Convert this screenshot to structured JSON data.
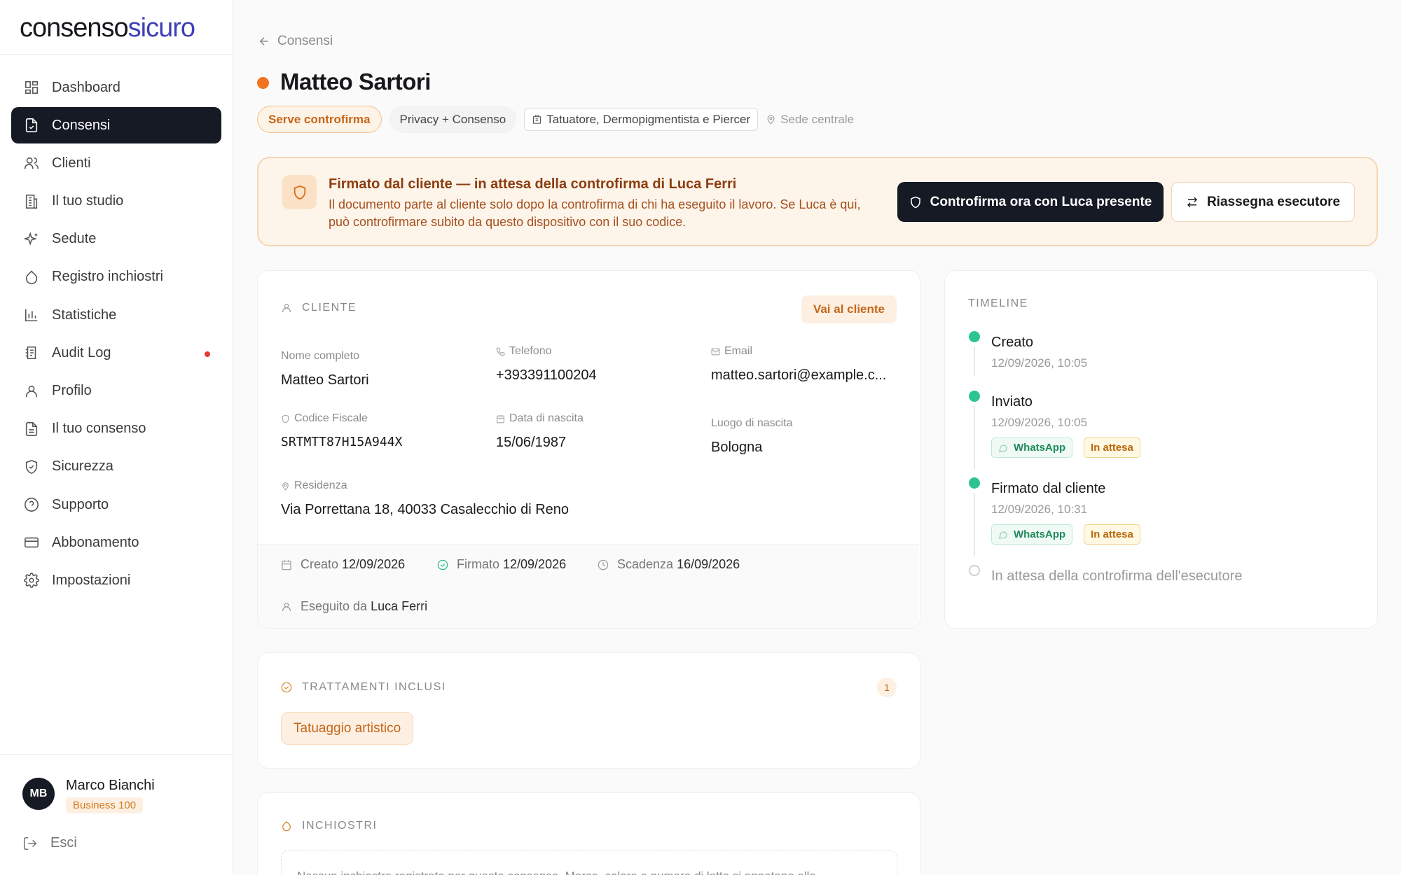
{
  "app": {
    "logo_part1": "consenso",
    "logo_part2": "sicuro",
    "brand_color": "#3f3fb8"
  },
  "sidebar": {
    "items": [
      {
        "label": "Dashboard",
        "icon": "dashboard-icon"
      },
      {
        "label": "Consensi",
        "icon": "document-icon",
        "active": true
      },
      {
        "label": "Clienti",
        "icon": "users-icon"
      },
      {
        "label": "Il tuo studio",
        "icon": "building-icon"
      },
      {
        "label": "Sedute",
        "icon": "sparkles-icon"
      },
      {
        "label": "Registro inchiostri",
        "icon": "droplet-icon"
      },
      {
        "label": "Statistiche",
        "icon": "bar-chart-icon"
      },
      {
        "label": "Audit Log",
        "icon": "audit-icon",
        "notification": true
      },
      {
        "label": "Profilo",
        "icon": "user-icon"
      },
      {
        "label": "Il tuo consenso",
        "icon": "file-icon"
      },
      {
        "label": "Sicurezza",
        "icon": "shield-check-icon"
      },
      {
        "label": "Supporto",
        "icon": "help-circle-icon"
      },
      {
        "label": "Abbonamento",
        "icon": "credit-card-icon"
      },
      {
        "label": "Impostazioni",
        "icon": "gear-icon"
      }
    ],
    "user": {
      "initials": "MB",
      "name": "Marco Bianchi",
      "plan": "Business 100"
    },
    "logout_label": "Esci"
  },
  "header": {
    "back_label": "Consensi",
    "title": "Matteo Sartori",
    "status_color": "#f0741f",
    "chips": {
      "status": "Serve controfirma",
      "type": "Privacy + Consenso",
      "category": "Tatuatore, Dermopigmentista e Piercer",
      "location": "Sede centrale"
    }
  },
  "banner": {
    "title": "Firmato dal cliente — in attesa della controfirma di Luca Ferri",
    "text": "Il documento parte al cliente solo dopo la controfirma di chi ha eseguito il lavoro. Se Luca è qui, può controfirmare subito da questo dispositivo con il suo codice.",
    "primary_button": "Controfirma ora con Luca presente",
    "secondary_button": "Riassegna esecutore"
  },
  "client": {
    "section_label": "CLIENTE",
    "go_button": "Vai al cliente",
    "fields": {
      "full_name_label": "Nome completo",
      "full_name": "Matteo Sartori",
      "phone_label": "Telefono",
      "phone": "+393391100204",
      "email_label": "Email",
      "email": "matteo.sartori@example.c...",
      "tax_code_label": "Codice Fiscale",
      "tax_code": "SRTMTT87H15A944X",
      "birth_date_label": "Data di nascita",
      "birth_date": "15/06/1987",
      "birth_place_label": "Luogo di nascita",
      "birth_place": "Bologna",
      "residence_label": "Residenza",
      "residence": "Via Porrettana 18, 40033 Casalecchio di Reno"
    },
    "meta": {
      "created_label": "Creato",
      "created": "12/09/2026",
      "signed_label": "Firmato",
      "signed": "12/09/2026",
      "expiry_label": "Scadenza",
      "expiry": "16/09/2026",
      "performed_label": "Eseguito da",
      "performed_by": "Luca Ferri"
    }
  },
  "timeline": {
    "heading": "TIMELINE",
    "events": [
      {
        "title": "Creato",
        "date": "12/09/2026, 10:05"
      },
      {
        "title": "Inviato",
        "date": "12/09/2026, 10:05",
        "channel": "WhatsApp",
        "status": "In attesa"
      },
      {
        "title": "Firmato dal cliente",
        "date": "12/09/2026, 10:31",
        "channel": "WhatsApp",
        "status": "In attesa"
      },
      {
        "title": "In attesa della controfirma dell'esecutore"
      }
    ]
  },
  "treatments": {
    "section_label": "TRATTAMENTI INCLUSI",
    "count": "1",
    "items": [
      "Tatuaggio artistico"
    ]
  },
  "inks": {
    "section_label": "INCHIOSTRI",
    "note": "Nessun inchiostro registrato per questo consenso. Marca, colore e numero di lotto si annotano alla"
  }
}
